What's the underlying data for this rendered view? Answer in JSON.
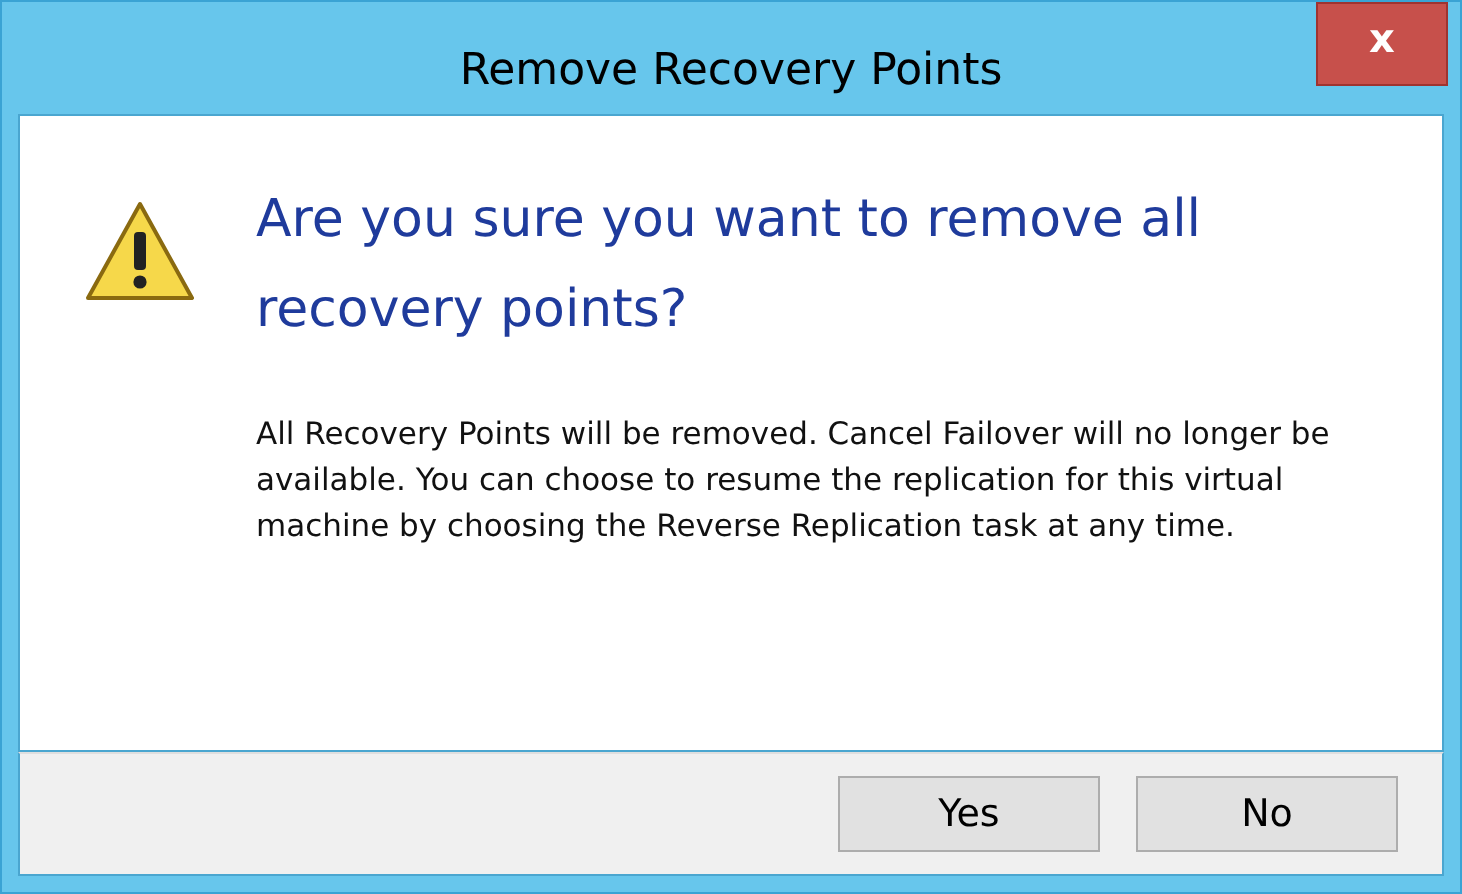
{
  "window": {
    "title": "Remove Recovery Points",
    "close": "x"
  },
  "heading": "Are you sure you want to remove all recovery points?",
  "message": "All Recovery Points will be removed. Cancel Failover will no longer be available. You can choose to resume the replication for this virtual machine by choosing the Reverse Replication task at any time.",
  "buttons": [
    {
      "label": "Yes"
    },
    {
      "label": "No"
    }
  ]
}
